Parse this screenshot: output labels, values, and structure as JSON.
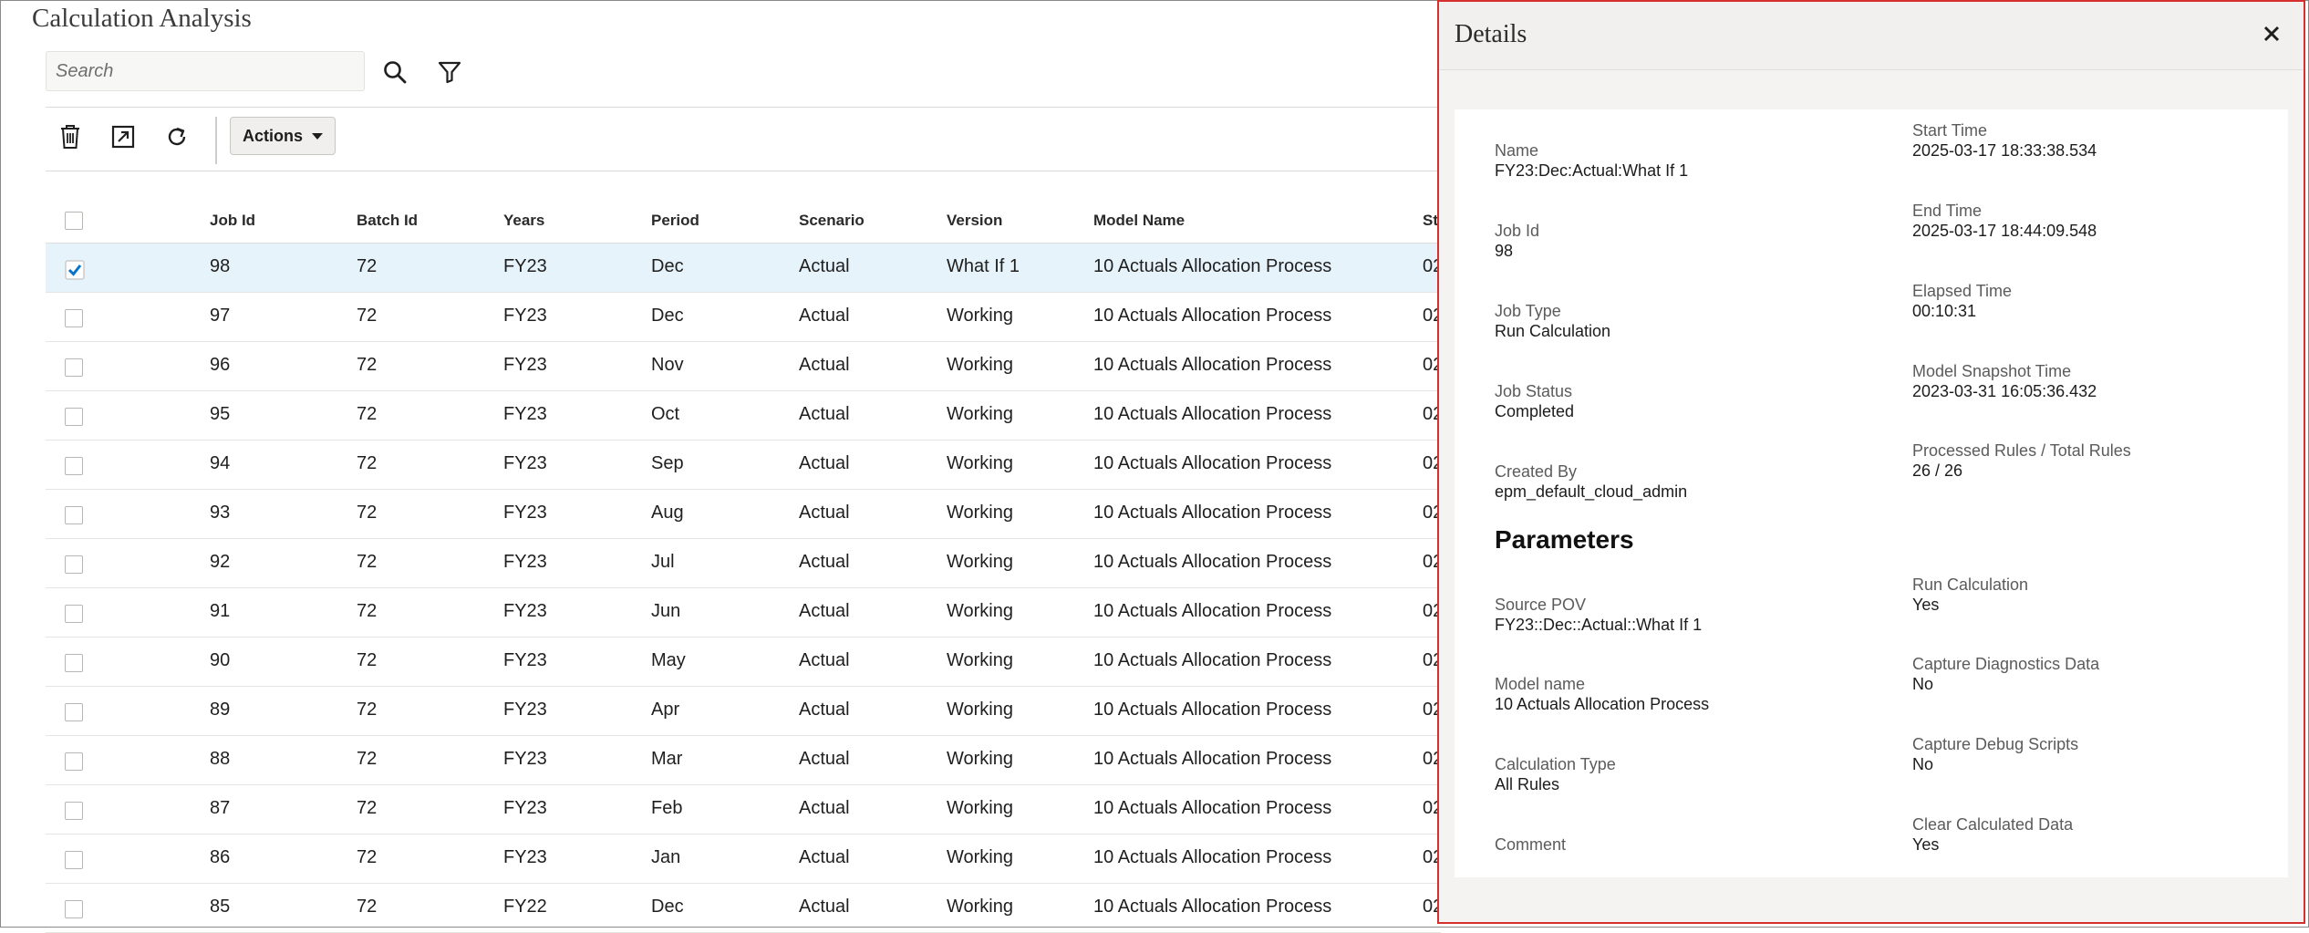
{
  "page": {
    "title": "Calculation Analysis"
  },
  "search": {
    "placeholder": "Search"
  },
  "toolbar": {
    "actions_label": "Actions"
  },
  "table": {
    "columns": [
      "Job Id",
      "Batch Id",
      "Years",
      "Period",
      "Scenario",
      "Version",
      "Model Name",
      "St"
    ],
    "rows": [
      {
        "job_id": "98",
        "batch_id": "72",
        "years": "FY23",
        "period": "Dec",
        "scenario": "Actual",
        "version": "What If 1",
        "model": "10 Actuals Allocation Process",
        "st": "02",
        "selected": true
      },
      {
        "job_id": "97",
        "batch_id": "72",
        "years": "FY23",
        "period": "Dec",
        "scenario": "Actual",
        "version": "Working",
        "model": "10 Actuals Allocation Process",
        "st": "02",
        "selected": false
      },
      {
        "job_id": "96",
        "batch_id": "72",
        "years": "FY23",
        "period": "Nov",
        "scenario": "Actual",
        "version": "Working",
        "model": "10 Actuals Allocation Process",
        "st": "02",
        "selected": false
      },
      {
        "job_id": "95",
        "batch_id": "72",
        "years": "FY23",
        "period": "Oct",
        "scenario": "Actual",
        "version": "Working",
        "model": "10 Actuals Allocation Process",
        "st": "02",
        "selected": false
      },
      {
        "job_id": "94",
        "batch_id": "72",
        "years": "FY23",
        "period": "Sep",
        "scenario": "Actual",
        "version": "Working",
        "model": "10 Actuals Allocation Process",
        "st": "02",
        "selected": false
      },
      {
        "job_id": "93",
        "batch_id": "72",
        "years": "FY23",
        "period": "Aug",
        "scenario": "Actual",
        "version": "Working",
        "model": "10 Actuals Allocation Process",
        "st": "02",
        "selected": false
      },
      {
        "job_id": "92",
        "batch_id": "72",
        "years": "FY23",
        "period": "Jul",
        "scenario": "Actual",
        "version": "Working",
        "model": "10 Actuals Allocation Process",
        "st": "02",
        "selected": false
      },
      {
        "job_id": "91",
        "batch_id": "72",
        "years": "FY23",
        "period": "Jun",
        "scenario": "Actual",
        "version": "Working",
        "model": "10 Actuals Allocation Process",
        "st": "02",
        "selected": false
      },
      {
        "job_id": "90",
        "batch_id": "72",
        "years": "FY23",
        "period": "May",
        "scenario": "Actual",
        "version": "Working",
        "model": "10 Actuals Allocation Process",
        "st": "02",
        "selected": false
      },
      {
        "job_id": "89",
        "batch_id": "72",
        "years": "FY23",
        "period": "Apr",
        "scenario": "Actual",
        "version": "Working",
        "model": "10 Actuals Allocation Process",
        "st": "02",
        "selected": false
      },
      {
        "job_id": "88",
        "batch_id": "72",
        "years": "FY23",
        "period": "Mar",
        "scenario": "Actual",
        "version": "Working",
        "model": "10 Actuals Allocation Process",
        "st": "02",
        "selected": false
      },
      {
        "job_id": "87",
        "batch_id": "72",
        "years": "FY23",
        "period": "Feb",
        "scenario": "Actual",
        "version": "Working",
        "model": "10 Actuals Allocation Process",
        "st": "02",
        "selected": false
      },
      {
        "job_id": "86",
        "batch_id": "72",
        "years": "FY23",
        "period": "Jan",
        "scenario": "Actual",
        "version": "Working",
        "model": "10 Actuals Allocation Process",
        "st": "02",
        "selected": false
      },
      {
        "job_id": "85",
        "batch_id": "72",
        "years": "FY22",
        "period": "Dec",
        "scenario": "Actual",
        "version": "Working",
        "model": "10 Actuals Allocation Process",
        "st": "02",
        "selected": false
      }
    ]
  },
  "details": {
    "title": "Details",
    "left": [
      {
        "label": "Name",
        "value": "FY23:Dec:Actual:What If 1"
      },
      {
        "label": "Job Id",
        "value": "98"
      },
      {
        "label": "Job Type",
        "value": "Run Calculation"
      },
      {
        "label": "Job Status",
        "value": "Completed"
      },
      {
        "label": "Created By",
        "value": "epm_default_cloud_admin"
      }
    ],
    "right": [
      {
        "label": "Start Time",
        "value": "2025-03-17 18:33:38.534"
      },
      {
        "label": "End Time",
        "value": "2025-03-17 18:44:09.548"
      },
      {
        "label": "Elapsed Time",
        "value": "00:10:31"
      },
      {
        "label": "Model Snapshot Time",
        "value": "2023-03-31 16:05:36.432"
      },
      {
        "label": "Processed Rules / Total Rules",
        "value": "26 / 26"
      }
    ],
    "parameters_title": "Parameters",
    "params_left": [
      {
        "label": "Source POV",
        "value": "FY23::Dec::Actual::What If 1"
      },
      {
        "label": "Model name",
        "value": "10 Actuals Allocation Process"
      },
      {
        "label": "Calculation Type",
        "value": "All Rules"
      },
      {
        "label": "Comment",
        "value": ""
      }
    ],
    "params_right": [
      {
        "label": "Run Calculation",
        "value": "Yes"
      },
      {
        "label": "Capture Diagnostics Data",
        "value": "No"
      },
      {
        "label": "Capture Debug Scripts",
        "value": "No"
      },
      {
        "label": "Clear Calculated Data",
        "value": "Yes"
      }
    ]
  },
  "colors": {
    "panel_border": "#d62f2f",
    "selected_row": "#e7f3fa",
    "checkbox": "#0572ce"
  }
}
